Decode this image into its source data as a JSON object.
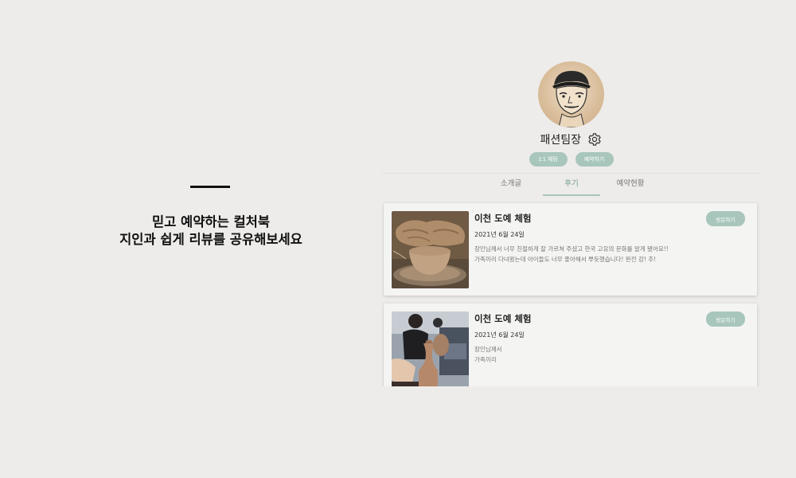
{
  "left": {
    "tagline_line1": "믿고 예약하는 컬처북",
    "tagline_line2": "지인과 쉽게 리뷰를 공유해보세요"
  },
  "profile": {
    "username": "패션팀장",
    "buttons": {
      "chat": "1:1 채팅",
      "reserve": "예약하기"
    },
    "tabs": [
      {
        "label": "소개글",
        "active": false
      },
      {
        "label": "후기",
        "active": true
      },
      {
        "label": "예약현황",
        "active": false
      }
    ]
  },
  "reviews": [
    {
      "title": "이천 도예 체험",
      "date": "2021년 6월 24일",
      "body_line1": "장인님께서 너무 친절하게 잘 가르쳐 주셨고 한국 고유의 문화를 알게 됐어요!!",
      "body_line2": "가족끼리 다녀왔는데 아이들도 너무 좋아해서 뿌듯했습니다! 완전 강! 추!",
      "visit_label": "방문하기"
    },
    {
      "title": "이천 도예 체험",
      "date": "2021년 6월 24일",
      "body_line1": "장인님께서",
      "body_line2": "가족끼리",
      "visit_label": "방문하기"
    }
  ],
  "colors": {
    "accent": "#a8c6bc",
    "background": "#eeecea",
    "card": "#f4f4f3"
  },
  "icons": {
    "settings": "gear-icon"
  }
}
